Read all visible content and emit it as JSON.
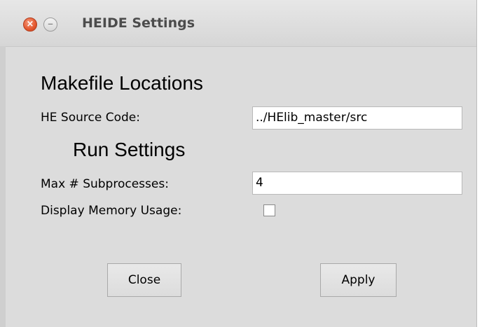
{
  "window": {
    "title": "HEIDE Settings",
    "close_glyph": "×",
    "minimize_glyph": "–"
  },
  "makefile": {
    "heading": "Makefile Locations",
    "source_label": "HE Source Code:",
    "source_value": "../HElib_master/src"
  },
  "run": {
    "heading": "Run Settings",
    "subprocesses_label": "Max # Subprocesses:",
    "subprocesses_value": "4",
    "memory_label": "Display Memory Usage:",
    "memory_checked": false
  },
  "buttons": {
    "close_label": "Close",
    "apply_label": "Apply"
  },
  "colors": {
    "window_bg": "#dcdcdc",
    "close_button": "#e4572e",
    "entry_bg": "#ffffff"
  }
}
